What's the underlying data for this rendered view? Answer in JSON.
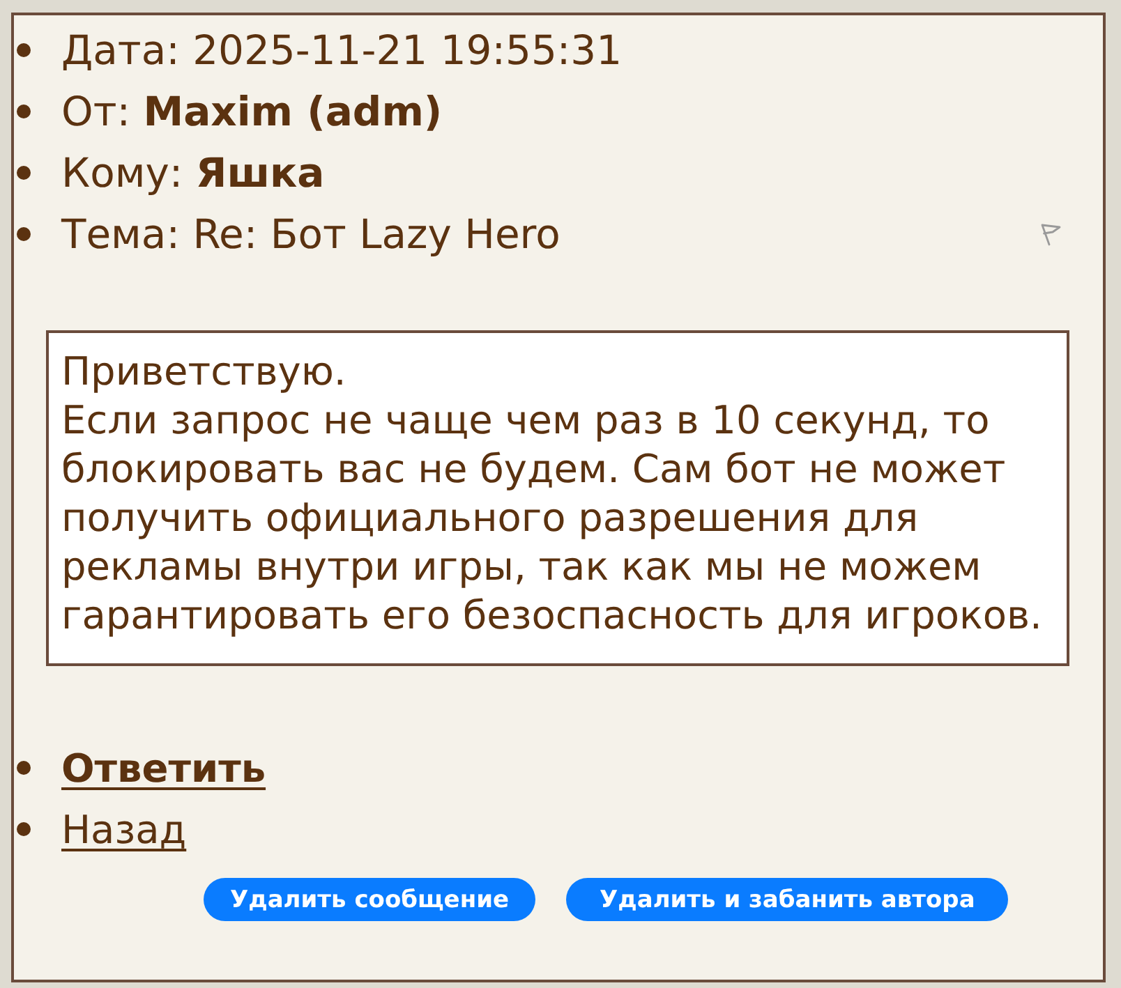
{
  "header": [
    "Дата: 2025-11-21 19:55:31",
    "От: **Maxim (adm)**",
    "Кому: **Яшка**",
    "Тема: Re: Бот Lazy Hero"
  ],
  "message": {
    "greeting": "Приветствую.",
    "text": "Если запрос не чаще чем раз в 10 секунд, то блокировать вас не будем. Сам бот не может получить официального разрешения для рекламы внутри игры, так как мы не можем гарантировать его безоспасность для игроков."
  },
  "links": [
    {
      "label": "Ответить",
      "bold": true
    },
    {
      "label": "Назад",
      "bold": false
    }
  ],
  "buttons": [
    "Удалить сообщение",
    "Удалить и забанить автора"
  ]
}
